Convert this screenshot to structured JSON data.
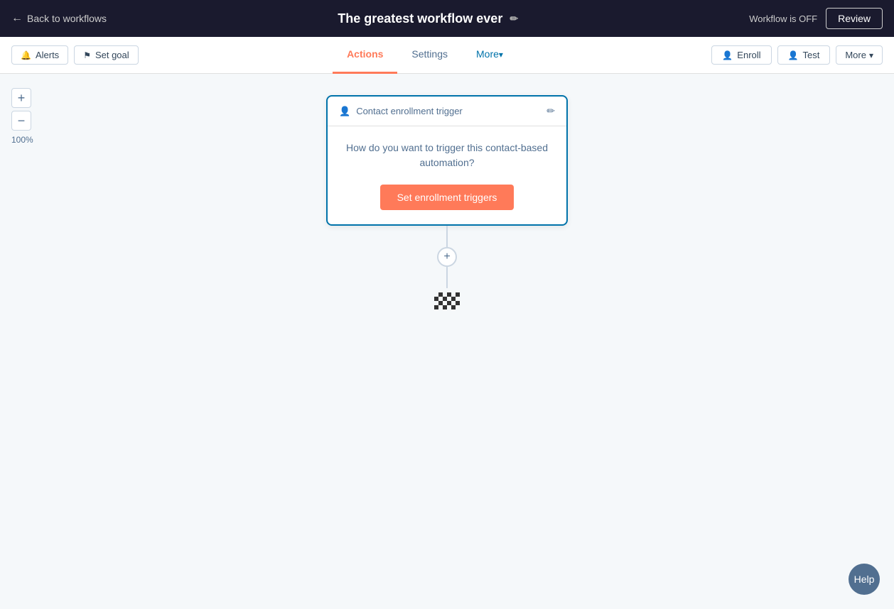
{
  "topbar": {
    "back_label": "Back to workflows",
    "title": "The greatest workflow ever",
    "workflow_status": "Workflow is OFF",
    "review_label": "Review"
  },
  "secondary_bar": {
    "alerts_label": "Alerts",
    "set_goal_label": "Set goal",
    "tabs": [
      {
        "id": "actions",
        "label": "Actions",
        "active": true
      },
      {
        "id": "settings",
        "label": "Settings",
        "active": false
      },
      {
        "id": "more",
        "label": "More",
        "active": false,
        "has_caret": true
      }
    ],
    "enroll_label": "Enroll",
    "test_label": "Test",
    "more_label": "More"
  },
  "canvas": {
    "zoom_plus": "+",
    "zoom_minus": "−",
    "zoom_level": "100%",
    "trigger_card": {
      "header_label": "Contact enrollment trigger",
      "body_text": "How do you want to trigger this contact-based automation?",
      "button_label": "Set enrollment triggers"
    },
    "add_step_icon": "+"
  },
  "help_button": {
    "label": "Help"
  }
}
